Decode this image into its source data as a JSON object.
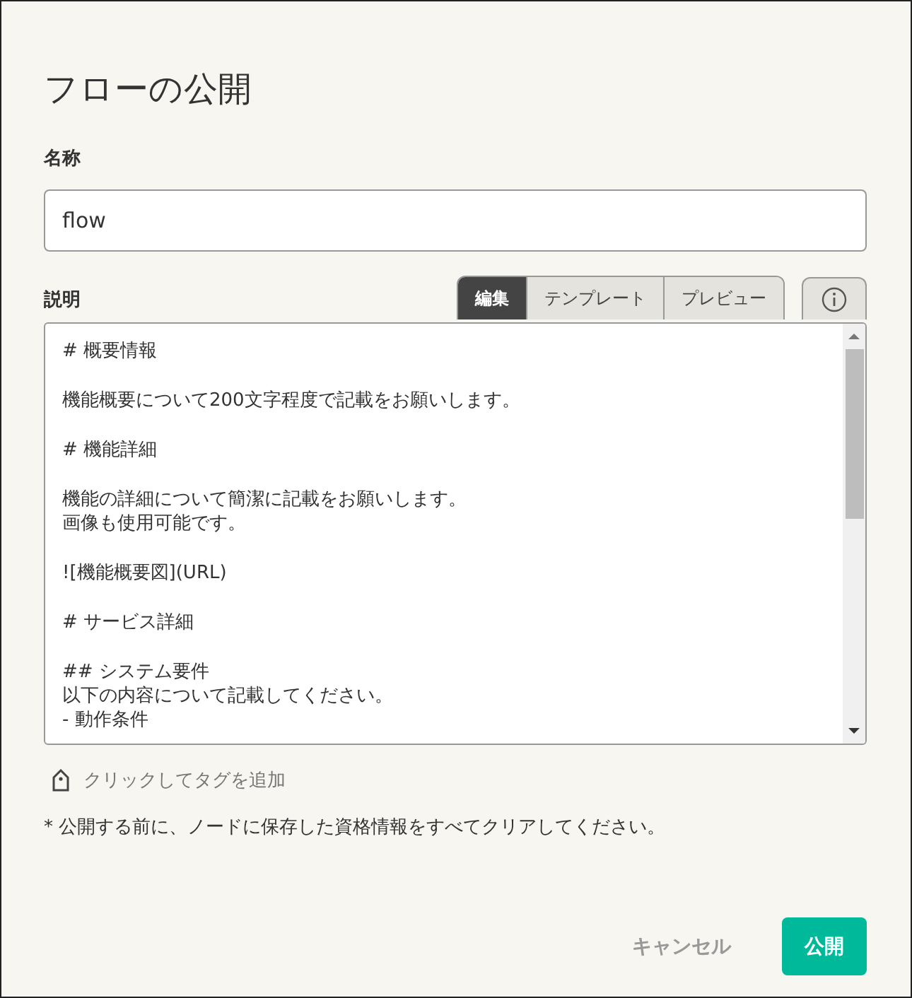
{
  "dialog": {
    "title": "フローの公開"
  },
  "name_field": {
    "label": "名称",
    "value": "flow"
  },
  "description": {
    "label": "説明",
    "tabs": [
      {
        "label": "編集",
        "selected": true
      },
      {
        "label": "テンプレート",
        "selected": false
      },
      {
        "label": "プレビュー",
        "selected": false
      }
    ],
    "paragraphs": [
      [
        "# 概要情報"
      ],
      [
        "機能概要について200文字程度で記載をお願いします。"
      ],
      [
        "# 機能詳細"
      ],
      [
        "機能の詳細について簡潔に記載をお願いします。",
        "画像も使用可能です。"
      ],
      [
        " ![機能概要図](URL)"
      ],
      [
        "# サービス詳細"
      ],
      [
        "## システム要件",
        "以下の内容について記載してください。",
        "- 動作条件"
      ]
    ]
  },
  "tag_link": "クリックしてタグを追加",
  "note": "* 公開する前に、ノードに保存した資格情報をすべてクリアしてください。",
  "buttons": {
    "cancel": "キャンセル",
    "publish": "公開"
  }
}
